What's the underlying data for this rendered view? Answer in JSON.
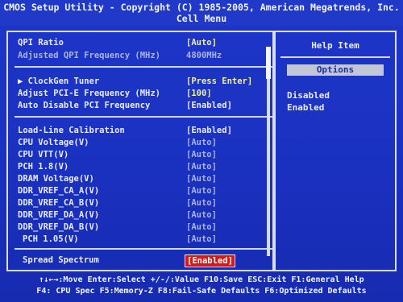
{
  "header": {
    "title_line": "CMOS Setup Utility - Copyright (C) 1985-2005, American Megatrends, Inc.",
    "menu_name": "Cell Menu"
  },
  "settings": {
    "qpi_ratio": {
      "label": "QPI Ratio",
      "value": "[Auto]"
    },
    "adjusted_qpi": {
      "label": "Adjusted QPI Frequency (MHz)",
      "value": "4800MHz"
    },
    "clockgen_tuner": {
      "arrow": "▶",
      "label": "ClockGen Tuner",
      "value": "[Press Enter]"
    },
    "adjust_pcie": {
      "label": "Adjust PCI-E Frequency (MHz)",
      "value": "[100]"
    },
    "auto_disable_pci": {
      "label": "Auto Disable PCI Frequency",
      "value": "[Enabled]"
    },
    "load_line": {
      "label": "Load-Line Calibration",
      "value": "[Enabled]"
    },
    "cpu_voltage": {
      "label": "CPU Voltage(V)",
      "value": "[Auto]"
    },
    "cpu_vtt": {
      "label": "CPU VTT(V)",
      "value": "[Auto]"
    },
    "pch_18": {
      "label": "PCH 1.8(V)",
      "value": "[Auto]"
    },
    "dram_voltage": {
      "label": "DRAM Voltage(V)",
      "value": "[Auto]"
    },
    "ddr_vref_ca_a": {
      "label": "DDR_VREF_CA_A(V)",
      "value": "[Auto]"
    },
    "ddr_vref_ca_b": {
      "label": "DDR_VREF_CA_B(V)",
      "value": "[Auto]"
    },
    "ddr_vref_da_a": {
      "label": "DDR_VREF_DA_A(V)",
      "value": "[Auto]"
    },
    "ddr_vref_da_b": {
      "label": "DDR_VREF_DA_B(V)",
      "value": "[Auto]"
    },
    "pch_105": {
      "label": "PCH 1.05(V)",
      "value": "[Auto]"
    },
    "spread_spectrum": {
      "label": "Spread Spectrum",
      "value": "[Enabled]"
    }
  },
  "help": {
    "title": "Help Item",
    "options_label": "Options",
    "options": [
      "Disabled",
      "Enabled"
    ]
  },
  "footer": {
    "line1": "↑↓←→:Move  Enter:Select  +/-/:Value  F10:Save  ESC:Exit  F1:General Help",
    "line2": "F4: CPU Spec  F5:Memory-Z  F8:Fail-Safe Defaults  F6:Optimized Defaults"
  },
  "colors": {
    "background": "#1b33c4",
    "highlight": "#d11a1a",
    "text": "#e8ecf8"
  }
}
